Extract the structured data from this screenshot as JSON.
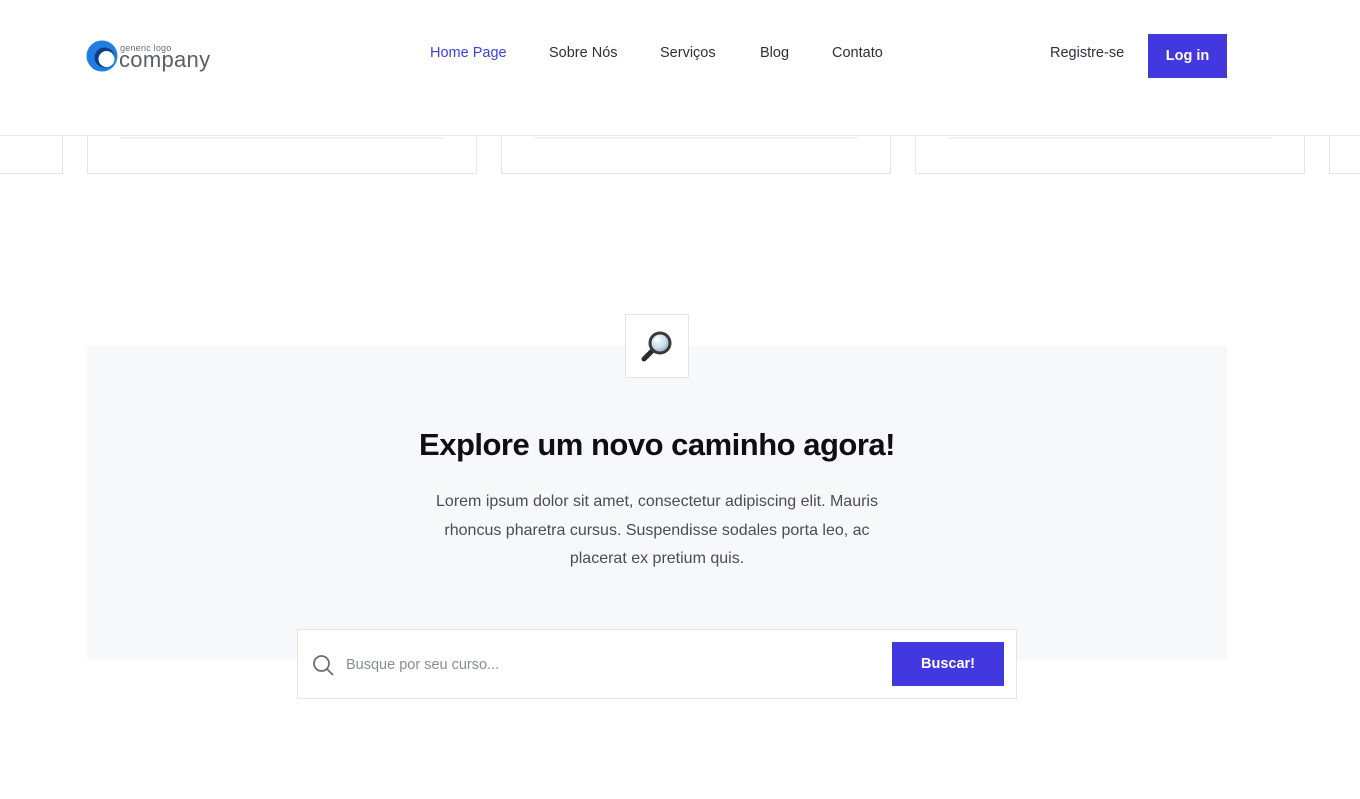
{
  "logo": {
    "small_text": "generic logo",
    "big_text": "company",
    "colors": {
      "primary": "#1f7ee0",
      "secondary": "#0d3d8a"
    }
  },
  "nav": {
    "items": [
      {
        "label": "Home Page",
        "active": true
      },
      {
        "label": "Sobre Nós",
        "active": false
      },
      {
        "label": "Serviços",
        "active": false
      },
      {
        "label": "Blog",
        "active": false
      },
      {
        "label": "Contato",
        "active": false
      }
    ],
    "register_label": "Registre-se",
    "login_label": "Log in"
  },
  "explore": {
    "icon": "magnifying-glass-icon",
    "title": "Explore um novo caminho agora!",
    "description": "Lorem ipsum dolor sit amet, consectetur adipiscing elit. Mauris rhoncus pharetra cursus. Suspendisse sodales porta leo, ac placerat ex pretium quis."
  },
  "search": {
    "placeholder": "Busque por seu curso...",
    "value": "",
    "button_label": "Buscar!"
  },
  "colors": {
    "accent": "#4338e0",
    "active_link": "#3f3ee0",
    "section_bg": "#f7f8fa",
    "border": "#e4e5ea"
  }
}
